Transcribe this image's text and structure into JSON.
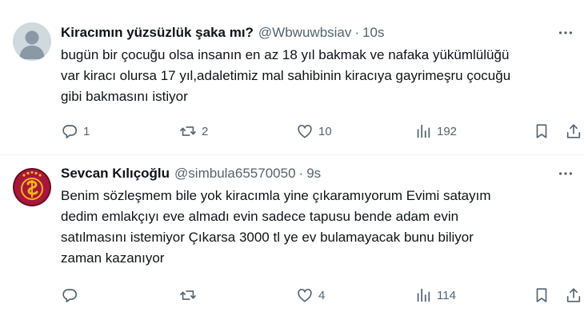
{
  "tweets": [
    {
      "name": "Kiracımın yüzsüzlük şaka mı?",
      "handle": "@Wbwuwbsiav",
      "separator": "·",
      "time": "10s",
      "text_lines": [
        "bugün bir çocuğu olsa insanın en az 18 yıl bakmak ve nafaka yükümlülüğü",
        "var kiracı olursa 17 yıl,adaletimiz mal sahibinin kiracıya gayrimeşru çocuğu",
        "gibi bakmasını istiyor"
      ],
      "replies": "1",
      "retweets": "2",
      "likes": "10",
      "views": "192",
      "avatar_icon": "default-profile-avatar"
    },
    {
      "name": "Sevcan Kılıçoğlu",
      "handle": "@simbula65570050",
      "separator": "·",
      "time": "9s",
      "text_lines": [
        "Benim sözleşmem bile yok kiracımla yine çıkaramıyorum Evimi satayım",
        "dedim emlakçıyı eve almadı evin sadece tapusu bende adam evin",
        "satılmasını istemiyor Çıkarsa 3000 tl ye ev bulamayacak bunu biliyor",
        "zaman  kazanıyor"
      ],
      "replies": "",
      "retweets": "",
      "likes": "4",
      "views": "114",
      "avatar_icon": "galatasaray-crest-avatar"
    }
  ],
  "colors": {
    "text_primary": "#0f1419",
    "text_secondary": "#536471",
    "divider": "#eff3f4",
    "avatar_default_bg": "#cfd9de",
    "crest_red": "#a9163a",
    "crest_gold": "#f2b317"
  }
}
